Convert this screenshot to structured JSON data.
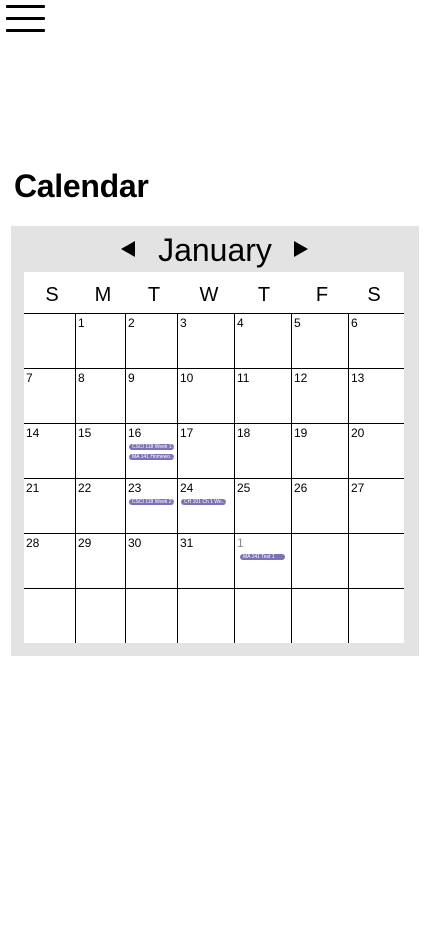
{
  "header": {
    "menu_icon": "hamburger-menu-icon"
  },
  "page": {
    "title": "Calendar"
  },
  "calendar": {
    "month": "January",
    "prev_icon": "triangle-left-icon",
    "next_icon": "triangle-right-icon",
    "weekdays": [
      "S",
      "M",
      "T",
      "W",
      "T",
      "F",
      "S"
    ],
    "event_color": "#7b73b6",
    "weeks": [
      [
        {
          "day": ""
        },
        {
          "day": "1"
        },
        {
          "day": "2"
        },
        {
          "day": "3"
        },
        {
          "day": "4"
        },
        {
          "day": "5"
        },
        {
          "day": "6"
        }
      ],
      [
        {
          "day": "7"
        },
        {
          "day": "8"
        },
        {
          "day": "9"
        },
        {
          "day": "10"
        },
        {
          "day": "11"
        },
        {
          "day": "12"
        },
        {
          "day": "13"
        }
      ],
      [
        {
          "day": "14"
        },
        {
          "day": "15"
        },
        {
          "day": "16",
          "events": [
            "CSCI 118 Week 1...",
            "MA 141 Homewo..."
          ]
        },
        {
          "day": "17"
        },
        {
          "day": "18"
        },
        {
          "day": "19"
        },
        {
          "day": "20"
        }
      ],
      [
        {
          "day": "21"
        },
        {
          "day": "22"
        },
        {
          "day": "23",
          "events": [
            "CSCI 118 Week 2..."
          ]
        },
        {
          "day": "24",
          "events": [
            "CH 101 Ch 1 We..."
          ]
        },
        {
          "day": "25"
        },
        {
          "day": "26"
        },
        {
          "day": "27"
        }
      ],
      [
        {
          "day": "28"
        },
        {
          "day": "29"
        },
        {
          "day": "30"
        },
        {
          "day": "31"
        },
        {
          "day": "1",
          "other_month": true,
          "events": [
            "MA 141 Test 1"
          ]
        },
        {
          "day": ""
        },
        {
          "day": ""
        }
      ],
      [
        {
          "day": ""
        },
        {
          "day": ""
        },
        {
          "day": ""
        },
        {
          "day": ""
        },
        {
          "day": ""
        },
        {
          "day": ""
        },
        {
          "day": ""
        }
      ]
    ]
  }
}
